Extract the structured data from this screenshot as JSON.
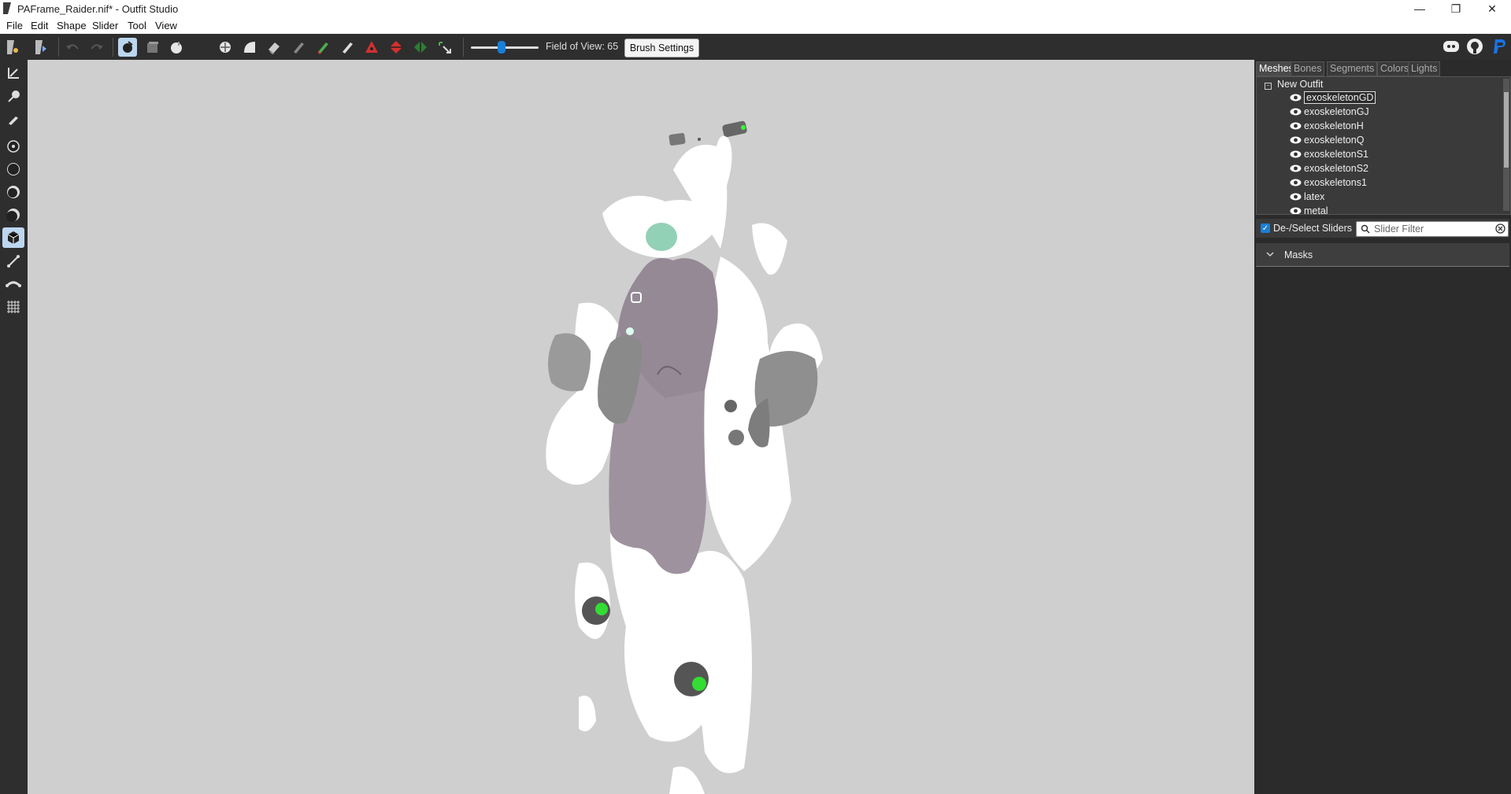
{
  "window": {
    "title": "PAFrame_Raider.nif* - Outfit Studio"
  },
  "menu": [
    "File",
    "Edit",
    "Shape",
    "Slider",
    "Tool",
    "View"
  ],
  "toolbar": {
    "fov_label": "Field of View: 65",
    "brush_settings": "Brush Settings",
    "fov_value": 65
  },
  "panel": {
    "tabs": [
      "Meshes",
      "Bones",
      "Segments",
      "Colors",
      "Lights"
    ],
    "root": "New Outfit",
    "meshes": [
      "exoskeletonGD",
      "exoskeletonGJ",
      "exoskeletonH",
      "exoskeletonQ",
      "exoskeletonS1",
      "exoskeletonS2",
      "exoskeletons1",
      "latex",
      "metal"
    ],
    "selected_mesh": "exoskeletonGD",
    "deselect_label": "De-/Select Sliders",
    "filter_placeholder": "Slider Filter",
    "masks_label": "Masks"
  }
}
